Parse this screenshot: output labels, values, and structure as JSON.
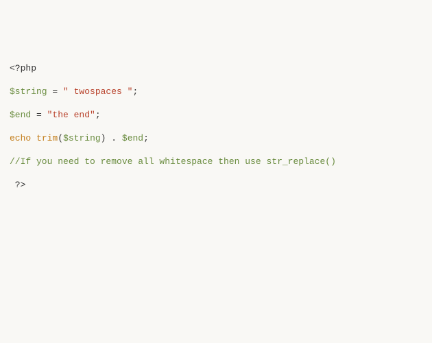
{
  "code": {
    "line1": {
      "open": "<?php"
    },
    "line2": {
      "var": "$string",
      "eq": " = ",
      "str": "\" twospaces \"",
      "semi": ";"
    },
    "line3": {
      "var": "$end",
      "eq": " = ",
      "str": "\"the end\"",
      "semi": ";"
    },
    "line4": {
      "kw": "echo",
      "sp1": " ",
      "fn": "trim",
      "open_paren": "(",
      "arg": "$string",
      "close_paren": ")",
      "concat": " . ",
      "var2": "$end",
      "semi": ";"
    },
    "line5": {
      "comment": "//If you need to remove all whitespace then use str_replace()"
    },
    "line6": {
      "close": " ?>"
    }
  }
}
